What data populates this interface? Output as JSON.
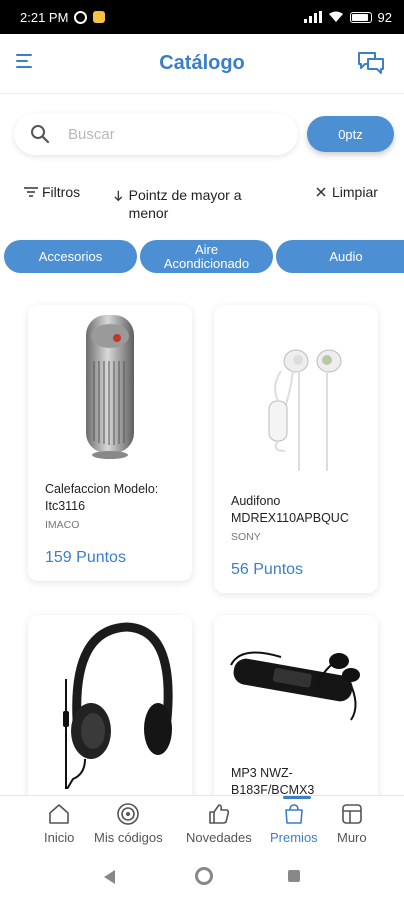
{
  "status_bar": {
    "time": "2:21 PM",
    "battery": "92"
  },
  "header": {
    "title": "Catálogo"
  },
  "search": {
    "placeholder": "Buscar",
    "value": ""
  },
  "points_button": {
    "label": "0ptz"
  },
  "filters": {
    "filter_label": "Filtros",
    "sort_label": "Pointz de mayor a menor",
    "clear_label": "Limpiar"
  },
  "categories": [
    {
      "label": "Accesorios"
    },
    {
      "label": "Aire Acondicionado"
    },
    {
      "label": "Audio"
    }
  ],
  "products": [
    {
      "name": "Calefaccion Modelo: Itc3116",
      "brand": "IMACO",
      "price": "159 Puntos",
      "image": "air-purifier-tower"
    },
    {
      "name": "Audifono MDREX110APBQUC",
      "brand": "SONY",
      "price": "56 Puntos",
      "image": "white-earphones"
    },
    {
      "name": "",
      "brand": "",
      "price": "",
      "image": "black-headphones"
    },
    {
      "name": "MP3 NWZ-B183F/BCMX3",
      "brand": "",
      "price": "",
      "image": "mp3-player"
    }
  ],
  "bottom_nav": [
    {
      "label": "Inicio",
      "icon": "home-icon"
    },
    {
      "label": "Mis códigos",
      "icon": "target-icon"
    },
    {
      "label": "Novedades",
      "icon": "thumbs-up-icon"
    },
    {
      "label": "Premios",
      "icon": "gift-bag-icon",
      "active": true
    },
    {
      "label": "Muro",
      "icon": "wall-icon"
    }
  ],
  "colors": {
    "accent": "#3a7fc7",
    "chip": "#4c8fd3"
  }
}
